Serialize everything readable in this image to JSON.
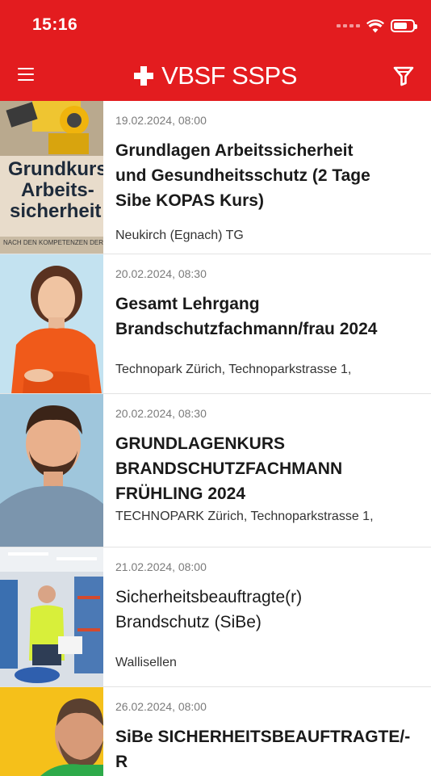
{
  "status": {
    "time": "15:16"
  },
  "header": {
    "logo_text": "VBSF SSPS",
    "menu_icon": "hamburger-menu-icon",
    "filter_icon": "filter-funnel-icon"
  },
  "colors": {
    "brand": "#e31c1f",
    "date": "#7b7b7b",
    "divider": "#e3e3e3"
  },
  "events": [
    {
      "date": "19.02.2024, 08:00",
      "title": "Grundlagen Arbeitssicherheit und Gesundheitsschutz (2 Tage Sibe KOPAS Kurs)",
      "location": "Neukirch (Egnach) TG",
      "thumb_text": [
        "Grundkurs",
        "Arbeits-",
        "sicherheit"
      ],
      "thumb_caption": "NACH DEN KOMPETENZEN DER"
    },
    {
      "date": "20.02.2024, 08:30",
      "title": "Gesamt Lehrgang Brandschutzfachmann/frau 2024",
      "location": "Technopark Zürich, Technoparkstrasse 1,"
    },
    {
      "date": "20.02.2024, 08:30",
      "title": "GRUNDLAGENKURS BRANDSCHUTZFACHMANN FRÜHLING 2024",
      "location": "TECHNOPARK Zürich, Technoparkstrasse 1,"
    },
    {
      "date": "21.02.2024, 08:00",
      "title": "Sicherheitsbeauftragte(r) Brandschutz (SiBe)",
      "location": "Wallisellen"
    },
    {
      "date": "26.02.2024, 08:00",
      "title": "SiBe SICHERHEITSBEAUFTRAGTE/-R",
      "location": ""
    }
  ]
}
